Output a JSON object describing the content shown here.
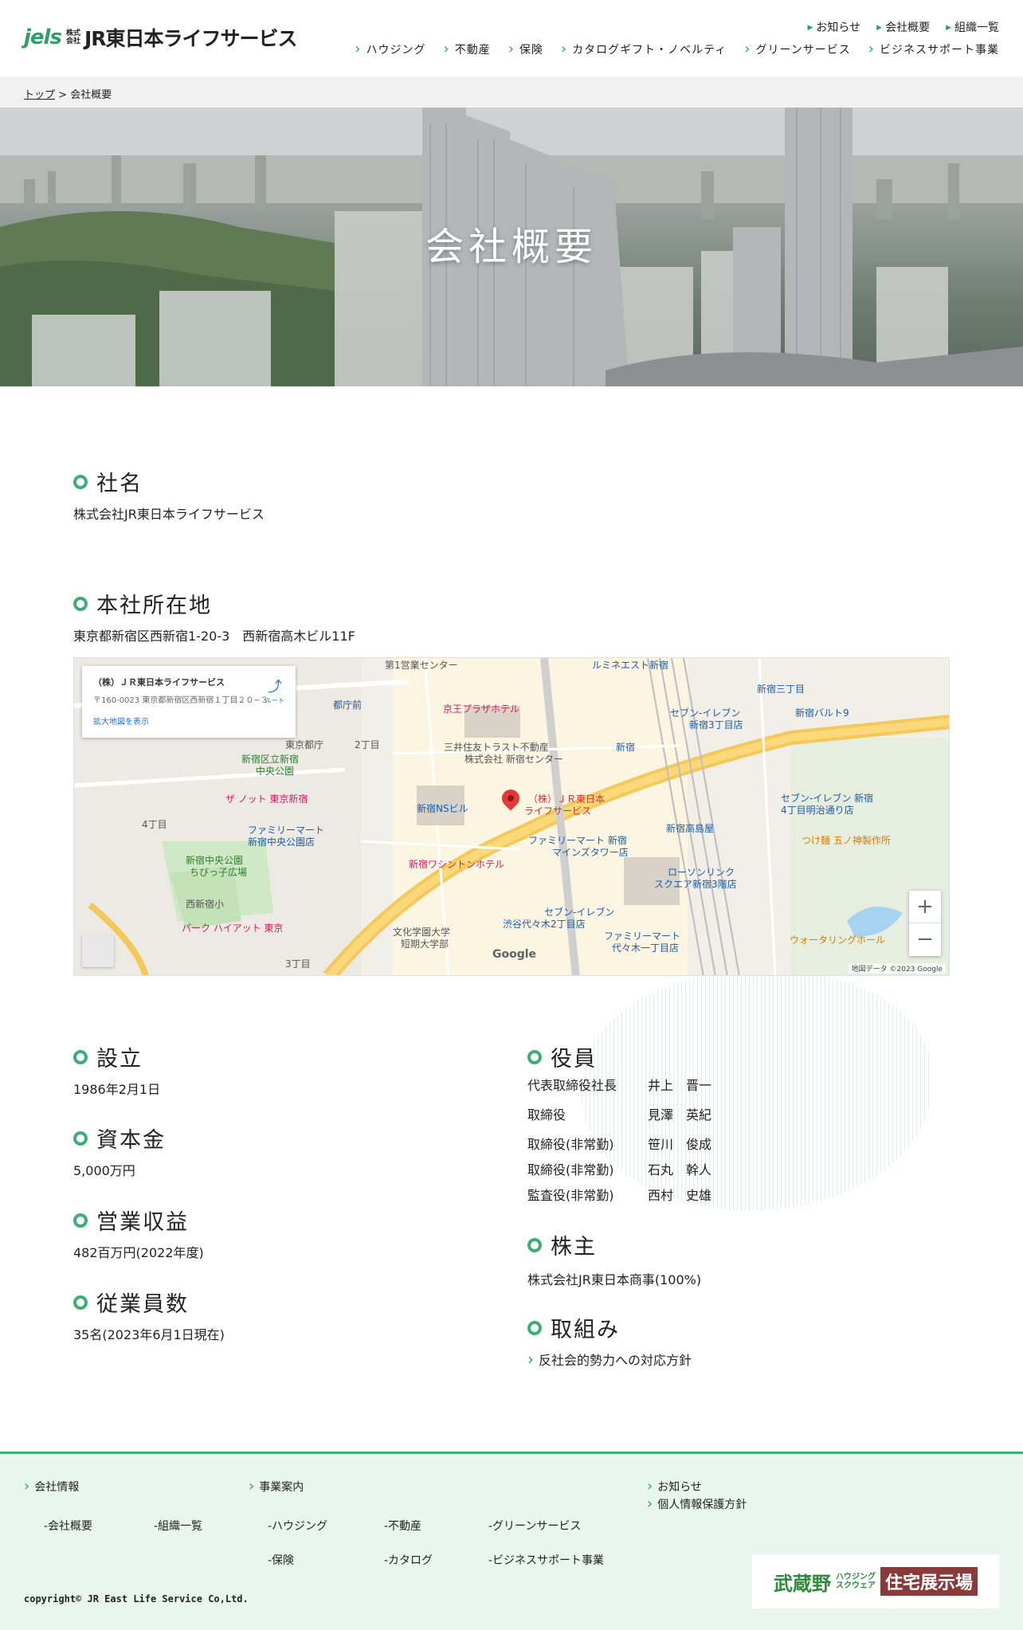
{
  "header": {
    "logo": {
      "mark": "jels",
      "kk_top": "株式",
      "kk_bottom": "会社",
      "name": "JR東日本ライフサービス"
    },
    "top_links": [
      "お知らせ",
      "会社概要",
      "組織一覧"
    ],
    "main_nav": [
      "ハウジング",
      "不動産",
      "保険",
      "カタログギフト・ノベルティ",
      "グリーンサービス",
      "ビジネスサポート事業"
    ]
  },
  "breadcrumb": {
    "home": "トップ",
    "separator": ">",
    "current": "会社概要"
  },
  "hero": {
    "title": "会社概要"
  },
  "company": {
    "name_title": "社名",
    "name_value": "株式会社JR東日本ライフサービス",
    "address_title": "本社所在地",
    "address_value": "東京都新宿区西新宿1-20-3　西新宿高木ビル11F",
    "founded_title": "設立",
    "founded_value": "1986年2月1日",
    "capital_title": "資本金",
    "capital_value": "5,000万円",
    "revenue_title": "営業収益",
    "revenue_value": "482百万円(2022年度)",
    "employees_title": "従業員数",
    "employees_value": "35名(2023年6月1日現在)",
    "officers_title": "役員",
    "officers": [
      {
        "role": "代表取締役社長",
        "name": "井上　晋一"
      },
      {
        "role": "取締役",
        "name": "見澤　英紀"
      },
      {
        "role": "取締役(非常勤)",
        "name": "笹川　俊成"
      },
      {
        "role": "取締役(非常勤)",
        "name": "石丸　幹人"
      },
      {
        "role": "監査役(非常勤)",
        "name": "西村　史雄"
      }
    ],
    "shareholder_title": "株主",
    "shareholder_value": "株式会社JR東日本商事(100%)",
    "initiatives_title": "取組み",
    "initiatives_link": "反社会的勢力への対応方針"
  },
  "map": {
    "card_name": "（株）ＪＲ東日本ライフサービス",
    "card_address": "〒160-0023 東京都新宿区西新宿１丁目２０−３",
    "card_link": "拡大地図を表示",
    "directions": "ルート",
    "pin_label_1": "（株）ＪＲ東日本",
    "pin_label_2": "ライフサービス",
    "zoom_in": "+",
    "zoom_out": "−",
    "attribution": "地図データ ©2023 Google",
    "google": "Google",
    "labels": {
      "keio": "京王プラザホテル",
      "mitsui": "三井住友トラスト不動産",
      "mitsui2": "株式会社 新宿センター",
      "tocho": "都庁前",
      "tochosha": "東京都庁",
      "park": "新宿区立新宿",
      "park2": "中央公園",
      "ns": "新宿NSビル",
      "washington": "新宿ワシントンホテル",
      "sunroute": "ザ ノット 東京新宿",
      "hyatt": "パーク ハイアット 東京",
      "famima1": "ファミリーマート",
      "famima1b": "新宿中央公園店",
      "chuo_park": "新宿中央公園",
      "chuo_park2": "ちびっ子広場",
      "famima2": "ファミリーマート 新宿",
      "famima2b": "マインズタワー店",
      "seven1": "セブン-イレブン",
      "seven1b": "渋谷代々木2丁目店",
      "famima3": "ファミリーマート",
      "famima3b": "代々木一丁目店",
      "lawson": "ローソンリンク",
      "lawson2": "スクエア新宿3階店",
      "bunka": "文化学園大学",
      "bunka2": "短期大学部",
      "takashimaya": "新宿高島屋",
      "shinjuku": "新宿",
      "sanchome": "新宿三丁目",
      "marui": "新宿バルト9",
      "seven2": "セブン-イレブン",
      "seven2b": "新宿3丁目店",
      "seven3": "セブン-イレブン 新宿",
      "seven3b": "4丁目明治通り店",
      "tsukemen": "つけ麺 五ノ神製作所",
      "water": "ウォータリングホール",
      "lumine": "ルミネエスト新宿",
      "dai1": "第1営業センター",
      "nishi_sho": "西新宿小",
      "chome2": "2丁目",
      "chome3": "3丁目",
      "chome4": "4丁目"
    }
  },
  "footer": {
    "company_info": "会社情報",
    "company_items": [
      "-会社概要",
      "-組織一覧"
    ],
    "business": "事業案内",
    "business_items": [
      "-ハウジング",
      "-不動産",
      "-グリーンサービス",
      "-保険",
      "-カタログ",
      "-ビジネスサポート事業"
    ],
    "news": "お知らせ",
    "privacy": "個人情報保護方針",
    "copyright": "copyright© JR East Life Service Co,Ltd.",
    "banner": {
      "main": "武蔵野",
      "sub1": "ハウジング",
      "sub2": "スクウェア",
      "tag": "住宅展示場"
    }
  },
  "colors": {
    "accent": "#3fae74",
    "footer_bg": "#e9f6ef",
    "breadcrumb_bg": "#f2f2f2"
  }
}
